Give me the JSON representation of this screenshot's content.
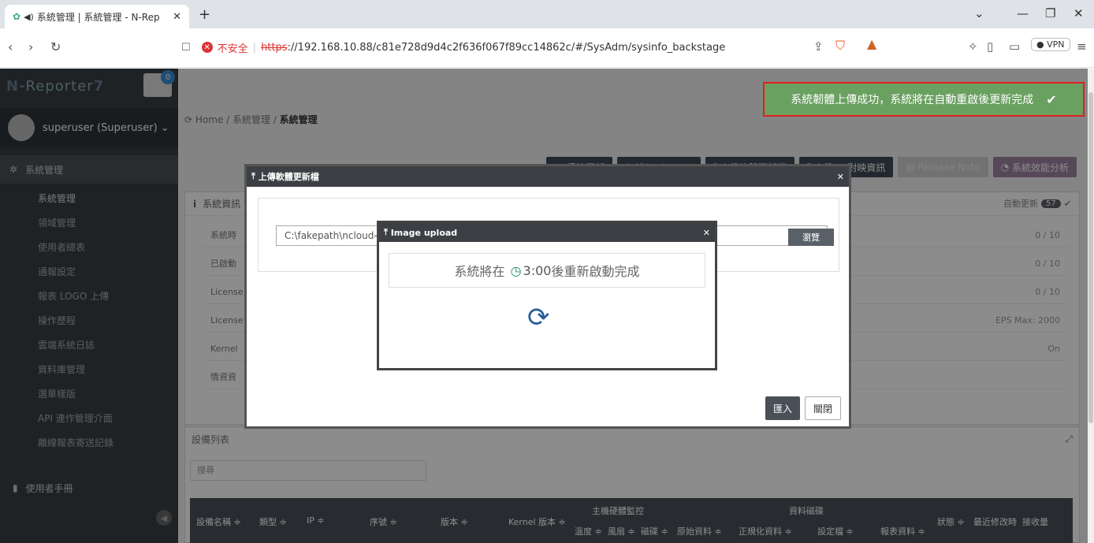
{
  "browser": {
    "tab_title": "系統管理 | 系統管理 - N-Rep",
    "new_tab": "+",
    "insecure": "不安全",
    "https": "https",
    "url_rest": "://192.168.10.88/c81e728d9d4c2f636f067f89cc14862c/#/SysAdm/sysinfo_backstage",
    "vpn": "VPN"
  },
  "app": {
    "logo_n": "N-",
    "logo_reporter": "Reporter",
    "logo_num": "7",
    "notify_count": "0",
    "user": "superuser (Superuser)",
    "menu_head": "系統管理",
    "menu_items": [
      "系統管理",
      "領域管理",
      "使用者總表",
      "通報設定",
      "報表 LOGO 上傳",
      "操作歷程",
      "雲端系統日誌",
      "資料庫管理",
      "選單樣版",
      "API 連作管理介面",
      "離線報表寄送記錄"
    ],
    "manual": "使用者手冊"
  },
  "breadcrumb": {
    "home": "Home",
    "mid": "系統管理",
    "current": "系統管理"
  },
  "buttons": {
    "sys_update": "系統更新",
    "license": "輸入 License",
    "firmware": "上傳軟體更新檔",
    "ip_map": "上傳 IP 對映資訊",
    "release_note": "Release Note",
    "perf": "系統效能分析"
  },
  "sysinfo": {
    "title": "系統資訊",
    "auto_update": "自動更新",
    "auto_update_count": "57",
    "rows": [
      {
        "label": "系統時",
        "value": "0 / 10"
      },
      {
        "label": "已啟動",
        "value": "0 / 10"
      },
      {
        "label": "License",
        "value": "0 / 10"
      },
      {
        "label": "License",
        "value": "EPS Max: 2000"
      },
      {
        "label": "Kernel",
        "value": "On"
      },
      {
        "label": "情資資",
        "value": ""
      }
    ]
  },
  "devices": {
    "title": "設備列表",
    "search_placeholder": "搜尋",
    "headers": {
      "name": "設備名稱 ≑",
      "type": "類型 ≑",
      "ip": "IP ≑",
      "serial": "序號 ≑",
      "version": "版本 ≑",
      "kernel": "Kernel 版本 ≑",
      "hw_group": "主機硬體監控",
      "temp": "溫度 ≑",
      "fan": "風扇 ≑",
      "disk": "磁碟 ≑",
      "data_group": "資料磁碟",
      "raw": "原始資料 ≑",
      "norm": "正規化資料 ≑",
      "config": "設定檔 ≑",
      "report": "報表資料 ≑",
      "status": "狀態 ≑",
      "modified": "最近修改時",
      "receive": "接收量"
    }
  },
  "upload_modal": {
    "title": "上傳軟體更新檔",
    "file_path": "C:\\fakepath\\ncloud-",
    "browse": "瀏覽",
    "import": "匯入",
    "close": "關閉"
  },
  "image_modal": {
    "title": "Image upload",
    "msg_pre": "系統將在",
    "time": "3:00",
    "msg_post": "後重新啟動完成"
  },
  "toast": {
    "message": "系統韌體上傳成功，系統將在自動重啟後更新完成"
  }
}
